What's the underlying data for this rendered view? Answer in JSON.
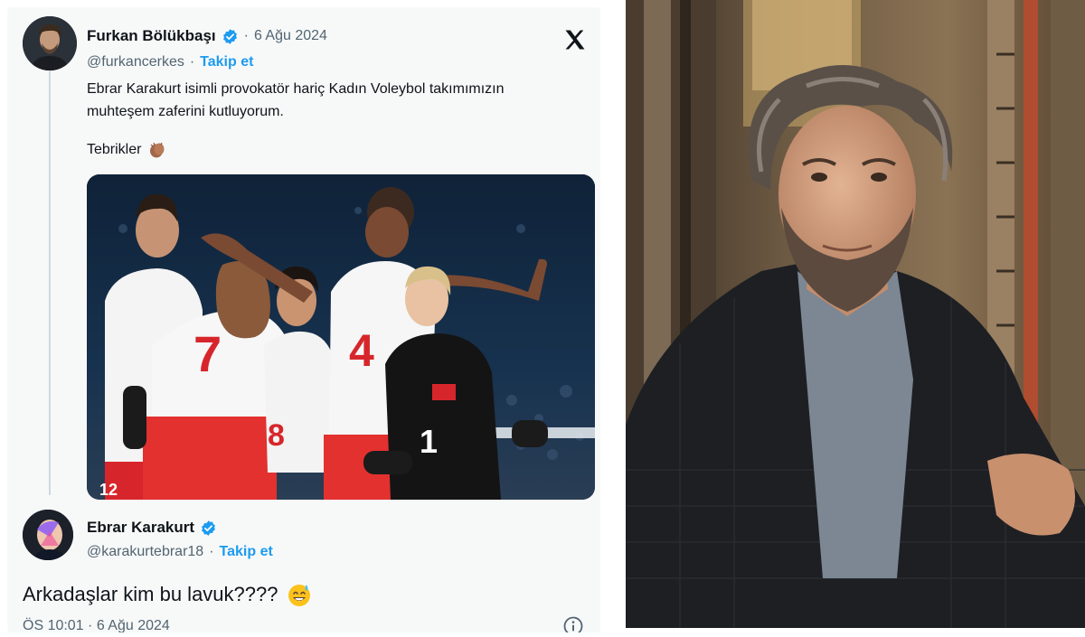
{
  "tweet": {
    "author": {
      "name": "Furkan Bölükbaşı",
      "handle": "@furkancerkes",
      "follow_label": "Takip et",
      "date": "6 Ağu 2024"
    },
    "text_line1": "Ebrar Karakurt isimli provokatör hariç Kadın Voleybol takımımızın",
    "text_line2": "muhteşem zaferini kutluyorum.",
    "congrats": "Tebrikler",
    "separator": "·",
    "platform_icon": "x-logo-icon",
    "media_jersey_numbers": [
      "7",
      "4",
      "1",
      "8",
      "12"
    ]
  },
  "reply": {
    "author": {
      "name": "Ebrar Karakurt",
      "handle": "@karakurtebrar18",
      "follow_label": "Takip et"
    },
    "text": "Arkadaşlar kim bu lavuk????",
    "timestamp": "ÖS 10:01 · 6 Ağu 2024"
  },
  "colors": {
    "accent": "#1d9bf0",
    "text": "#0f1419",
    "secondary_text": "#536471",
    "panel_bg": "#f7f9f9"
  }
}
